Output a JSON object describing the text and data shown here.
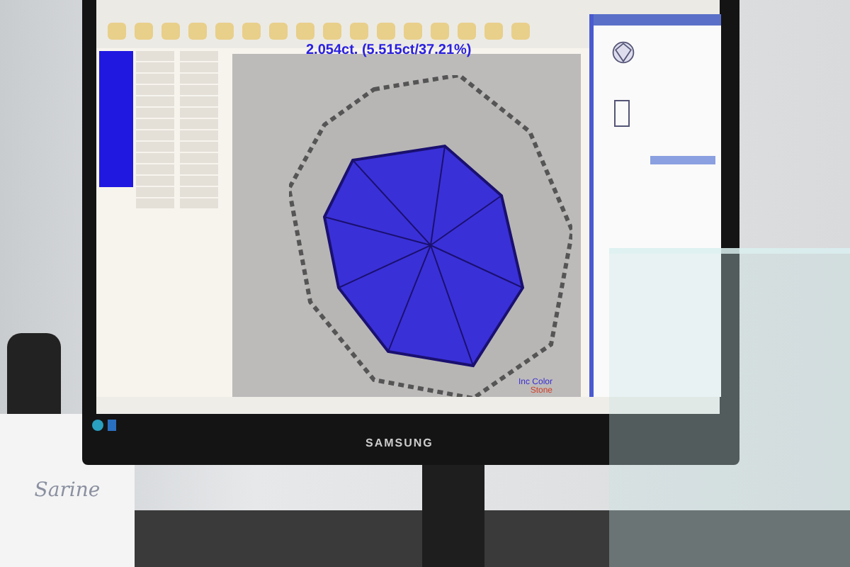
{
  "measurement": {
    "text": "2.054ct. (5.515ct/37.21%)"
  },
  "legend": [
    {
      "label": "Inc Color",
      "color": "#3a2fd0"
    },
    {
      "label": "Stone",
      "color": "#d0402a"
    }
  ],
  "monitor": {
    "brand": "SAMSUNG"
  },
  "card": {
    "logo": "Sarine"
  }
}
